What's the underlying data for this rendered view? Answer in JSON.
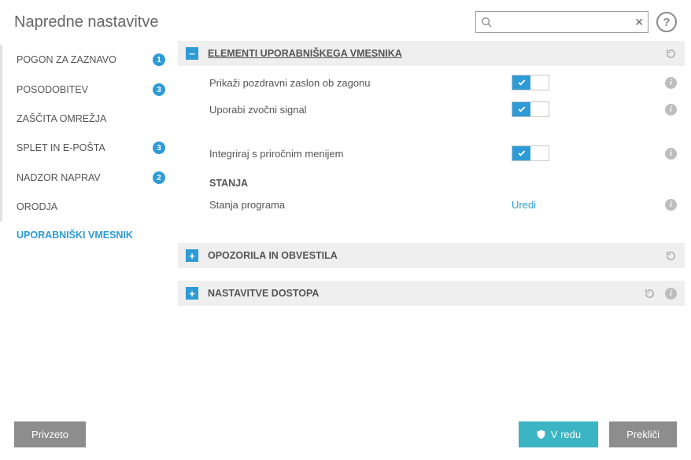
{
  "header": {
    "title": "Napredne nastavitve",
    "search_placeholder": "",
    "help_label": "?"
  },
  "sidebar": {
    "items": [
      {
        "label": "POGON ZA ZAZNAVO",
        "badge": "1"
      },
      {
        "label": "POSODOBITEV",
        "badge": "3"
      },
      {
        "label": "ZAŠČITA OMREŽJA",
        "badge": ""
      },
      {
        "label": "SPLET IN E-POŠTA",
        "badge": "3"
      },
      {
        "label": "NADZOR NAPRAV",
        "badge": "2"
      },
      {
        "label": "ORODJA",
        "badge": ""
      },
      {
        "label": "UPORABNIŠKI VMESNIK",
        "badge": ""
      }
    ],
    "active_index": 6
  },
  "sections": {
    "ui_elements": {
      "title": "ELEMENTI UPORABNIŠKEGA VMESNIKA",
      "collapsed": false,
      "rows": [
        {
          "label": "Prikaži pozdravni zaslon ob zagonu",
          "toggle": true
        },
        {
          "label": "Uporabi zvočni signal",
          "toggle": true
        },
        {
          "label": "Integriraj s priročnim menijem",
          "toggle": true
        }
      ],
      "states_heading": "STANJA",
      "states_row_label": "Stanja programa",
      "states_action": "Uredi"
    },
    "alerts": {
      "title": "OPOZORILA IN OBVESTILA",
      "collapsed": true
    },
    "access": {
      "title": "NASTAVITVE DOSTOPA",
      "collapsed": true
    }
  },
  "footer": {
    "default_label": "Privzeto",
    "ok_label": "V redu",
    "cancel_label": "Prekliči"
  }
}
